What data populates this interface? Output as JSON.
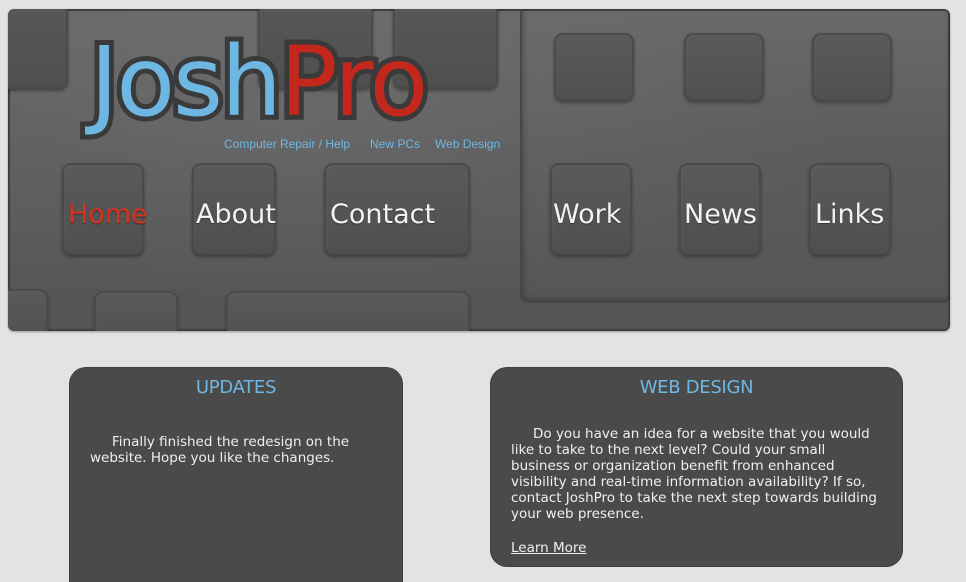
{
  "header": {
    "logo_part1": "Josh",
    "logo_part2": "Pro",
    "taglines": [
      "Computer Repair / Help",
      "New PCs",
      "Web Design"
    ]
  },
  "nav": {
    "items": [
      {
        "label": "Home",
        "active": true
      },
      {
        "label": "About",
        "active": false
      },
      {
        "label": "Contact",
        "active": false
      },
      {
        "label": "Work",
        "active": false
      },
      {
        "label": "News",
        "active": false
      },
      {
        "label": "Links",
        "active": false
      }
    ]
  },
  "panels": {
    "updates": {
      "title": "UPDATES",
      "body": "Finally finished the redesign on the website. Hope you like the changes."
    },
    "web_design": {
      "title": "WEB DESIGN",
      "body": "Do you have an idea for a website that you would like to take to the next level? Could your small business or organization benefit from enhanced visibility and real-time information availability? If so, contact JoshPro to take the next step towards building your web presence.",
      "link_label": "Learn More"
    }
  },
  "colors": {
    "accent_blue": "#6fb7e3",
    "accent_red": "#c4281c",
    "panel_bg": "#4a4a4a",
    "page_bg": "#e3e3e3"
  }
}
